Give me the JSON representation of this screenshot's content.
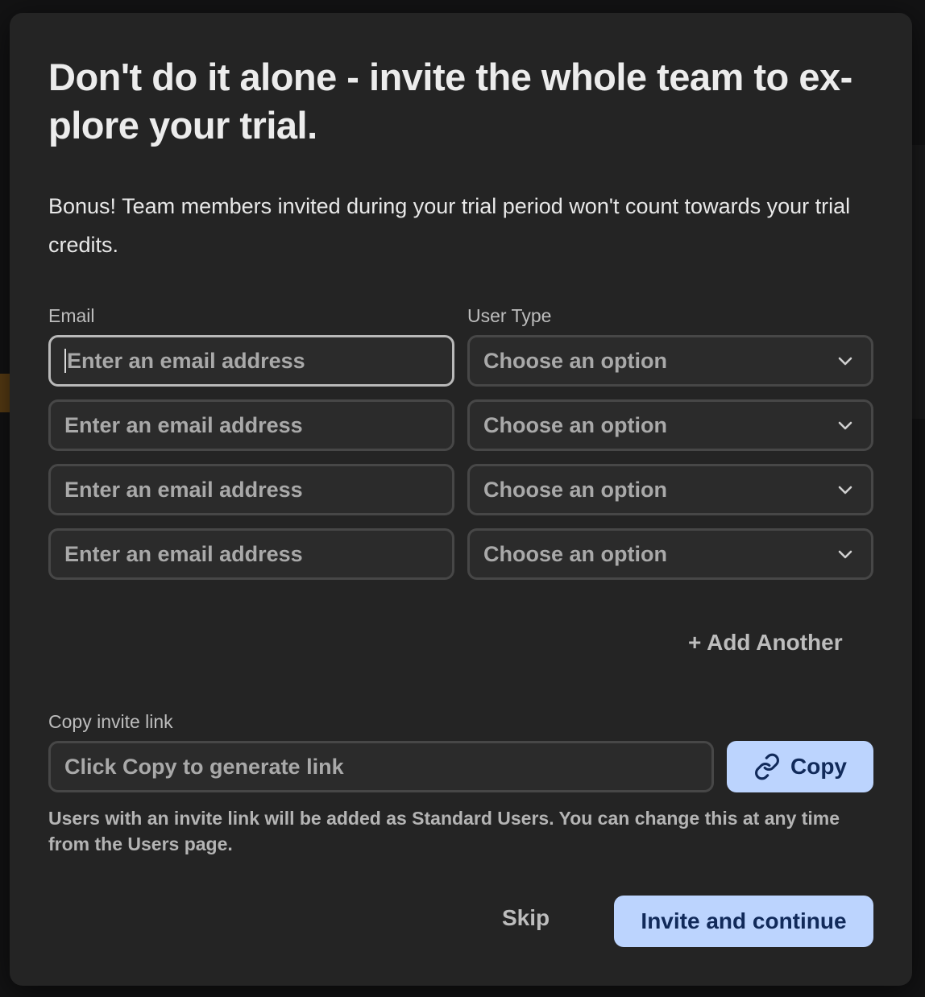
{
  "modal": {
    "title": "Don't do it alone - invite the whole team to ex-plore your trial.",
    "subtitle": "Bonus! Team members invited during your trial period won't count towards your trial credits."
  },
  "form": {
    "email_label": "Email",
    "user_type_label": "User Type",
    "rows": [
      {
        "email_placeholder": "Enter an email address",
        "user_type_value": "Choose an option"
      },
      {
        "email_placeholder": "Enter an email address",
        "user_type_value": "Choose an option"
      },
      {
        "email_placeholder": "Enter an email address",
        "user_type_value": "Choose an option"
      },
      {
        "email_placeholder": "Enter an email address",
        "user_type_value": "Choose an option"
      }
    ],
    "add_another_label": "+ Add Another"
  },
  "invite_link": {
    "label": "Copy invite link",
    "placeholder": "Click Copy to generate link",
    "copy_label": "Copy",
    "copy_icon": "link-icon",
    "note": "Users with an invite link will be added as Standard Users. You can change this at any time from the Users page."
  },
  "footer": {
    "skip_label": "Skip",
    "invite_label": "Invite and continue"
  },
  "colors": {
    "modal_bg": "#242424",
    "accent": "#bcd4fe",
    "accent_text": "#112a5a"
  }
}
